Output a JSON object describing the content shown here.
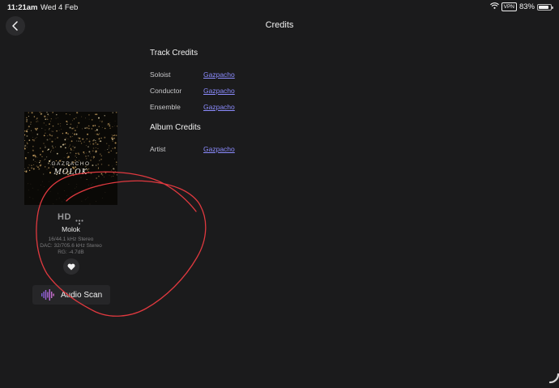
{
  "status_bar": {
    "time": "11:21am",
    "date": "Wed 4 Feb",
    "vpn": "VPN",
    "battery": "83%",
    "battery_level": 0.83
  },
  "header": {
    "title": "Credits",
    "back_icon": "chevron-left-icon"
  },
  "track_credits": {
    "title": "Track Credits",
    "rows": [
      {
        "role": "Soloist",
        "name": "Gazpacho"
      },
      {
        "role": "Conductor",
        "name": "Gazpacho"
      },
      {
        "role": "Ensemble",
        "name": "Gazpacho"
      }
    ]
  },
  "album_credits": {
    "title": "Album Credits",
    "rows": [
      {
        "role": "Artist",
        "name": "Gazpacho"
      }
    ]
  },
  "album": {
    "art_artist_text": "GAZPACHO",
    "art_title_text": "MOLOK"
  },
  "track": {
    "quality_badge": "HD",
    "title": "Molok",
    "format": "16/44.1 kHz Stereo",
    "dac": "DAC: 32/705.6 kHz Stereo",
    "rg": "RG: -4.7dB"
  },
  "actions": {
    "favorite_icon": "heart-icon",
    "audio_scan_label": "Audio Scan",
    "audio_scan_icon": "waveform-icon"
  },
  "colors": {
    "background": "#1b1b1c",
    "link": "#8c8cff",
    "annotation": "#e0393f"
  }
}
